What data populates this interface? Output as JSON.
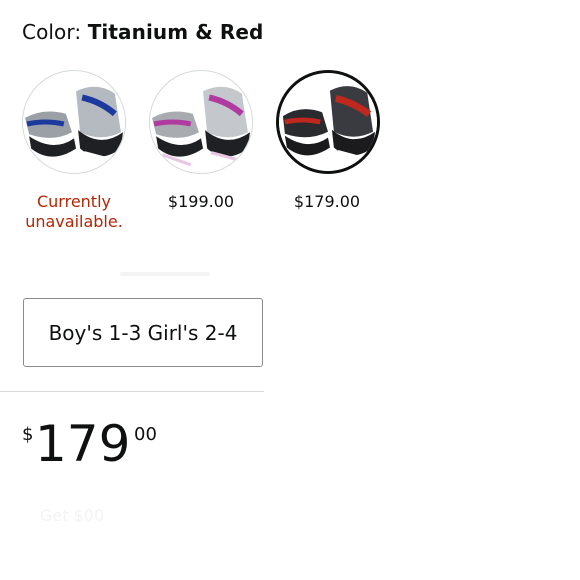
{
  "color_selector": {
    "label": "Color:",
    "selected": "Titanium & Red",
    "options": [
      {
        "name": "swatch-blue",
        "accent": "#1c3a9e",
        "label": "Currently unavailable.",
        "available": false
      },
      {
        "name": "swatch-purple",
        "accent": "#b03aa0",
        "label": "$199.00",
        "available": true
      },
      {
        "name": "swatch-red",
        "accent": "#c0281e",
        "label": "$179.00",
        "available": true,
        "selected": true
      }
    ]
  },
  "size_selector": {
    "value": "Boy's 1-3 Girl's 2-4"
  },
  "price": {
    "symbol": "$",
    "whole": "179",
    "fraction": "00"
  },
  "faded_text": "Get $00"
}
